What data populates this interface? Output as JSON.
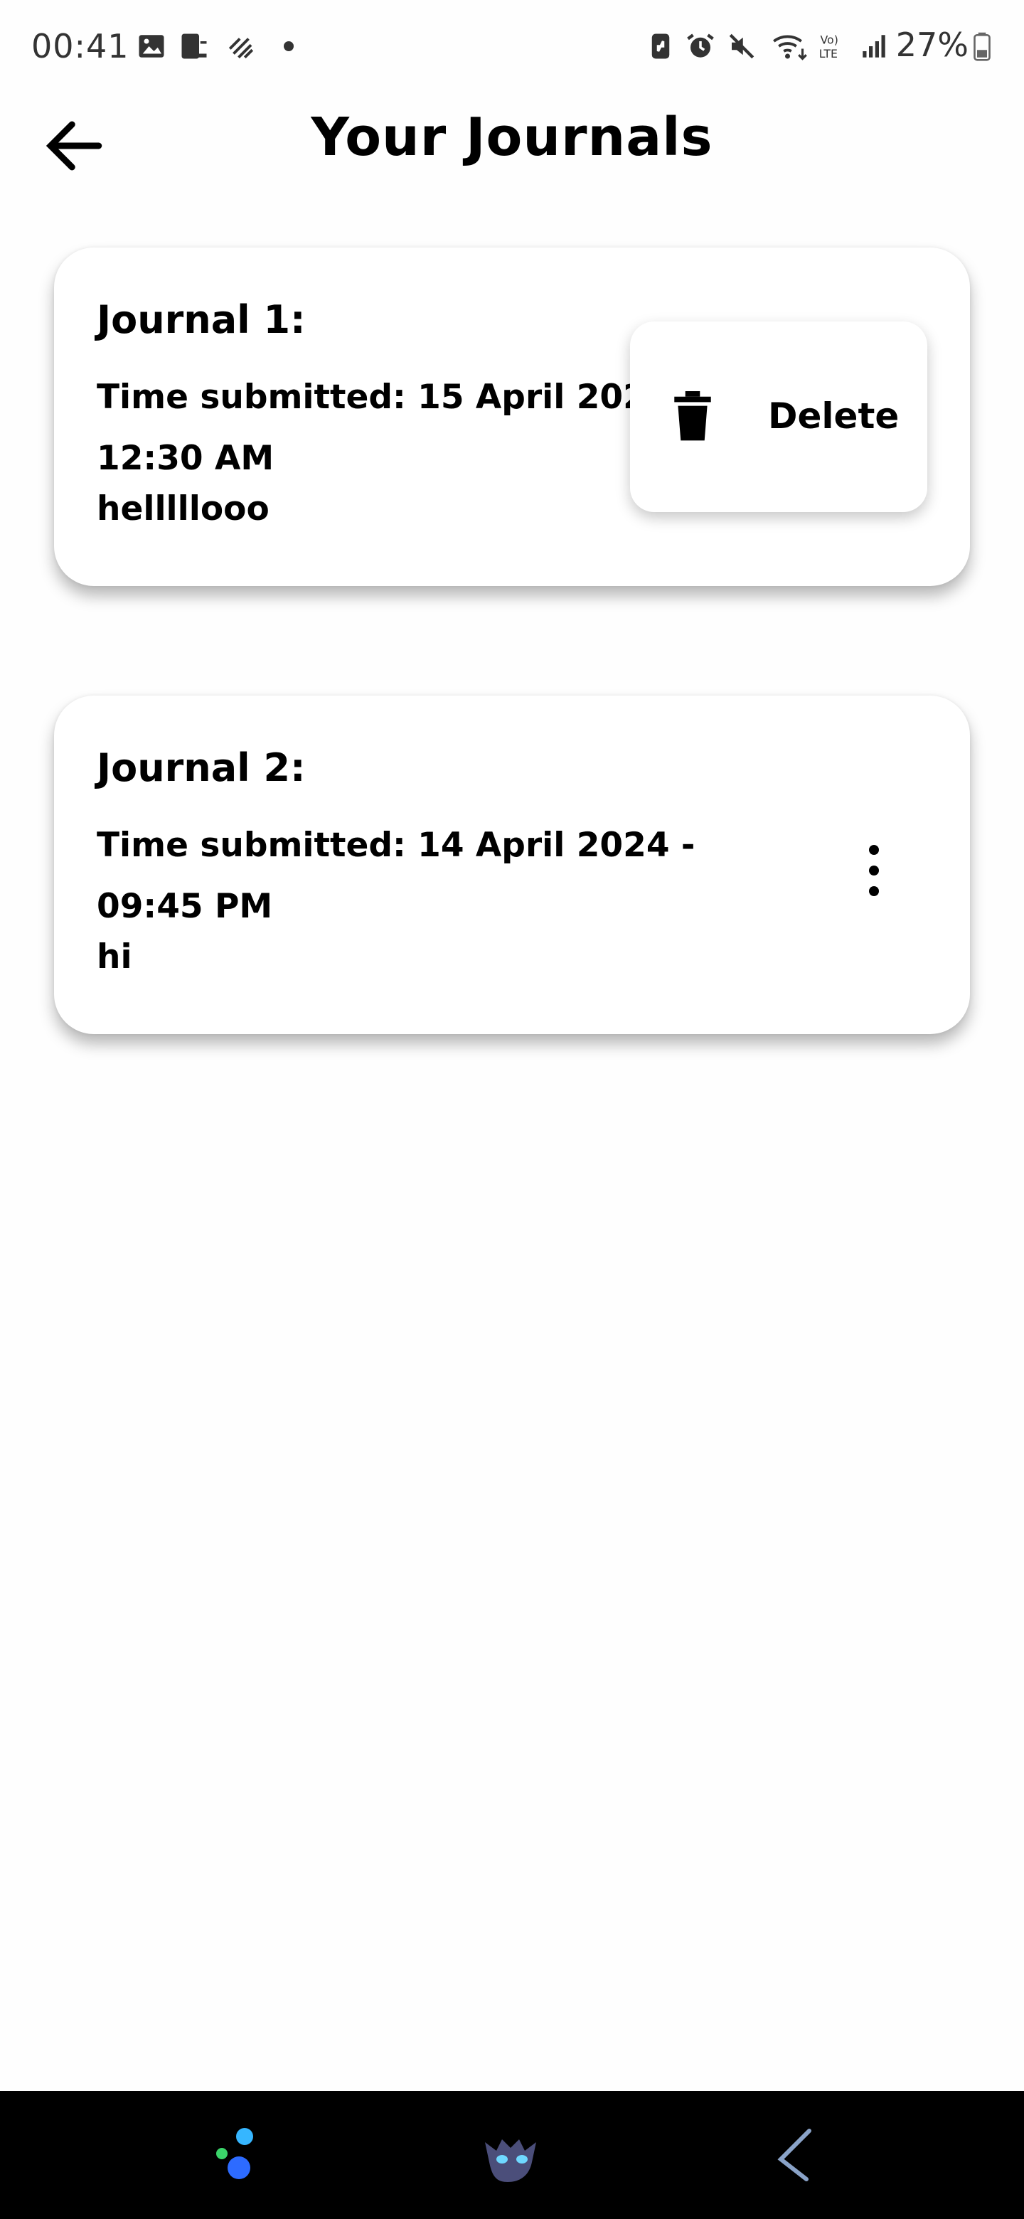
{
  "status_bar": {
    "time": "00:41",
    "battery": "27%",
    "icons": [
      "gallery-icon",
      "device-icon",
      "signal-noise-icon",
      "dot-icon",
      "battery-saver-icon",
      "alarm-icon",
      "mute-icon",
      "wifi-icon",
      "volte-icon",
      "cell-signal-icon",
      "battery-icon"
    ]
  },
  "header": {
    "title": "Your Journals",
    "back_icon": "arrow-left-icon"
  },
  "journals": [
    {
      "title": "Journal 1:",
      "time_text": "Time submitted: 15 April 2024 - 12:30 AM",
      "body": "helllllooo",
      "menu_open": true
    },
    {
      "title": "Journal 2:",
      "time_text": "Time submitted: 14 April 2024 - 09:45 PM",
      "body": "hi",
      "menu_open": false
    }
  ],
  "popup": {
    "delete_label": "Delete",
    "icon": "trash-icon"
  },
  "nav_bar": {
    "items": [
      "assistant-icon",
      "app-avatar-icon",
      "back-gesture-icon"
    ],
    "background": "#000000"
  }
}
